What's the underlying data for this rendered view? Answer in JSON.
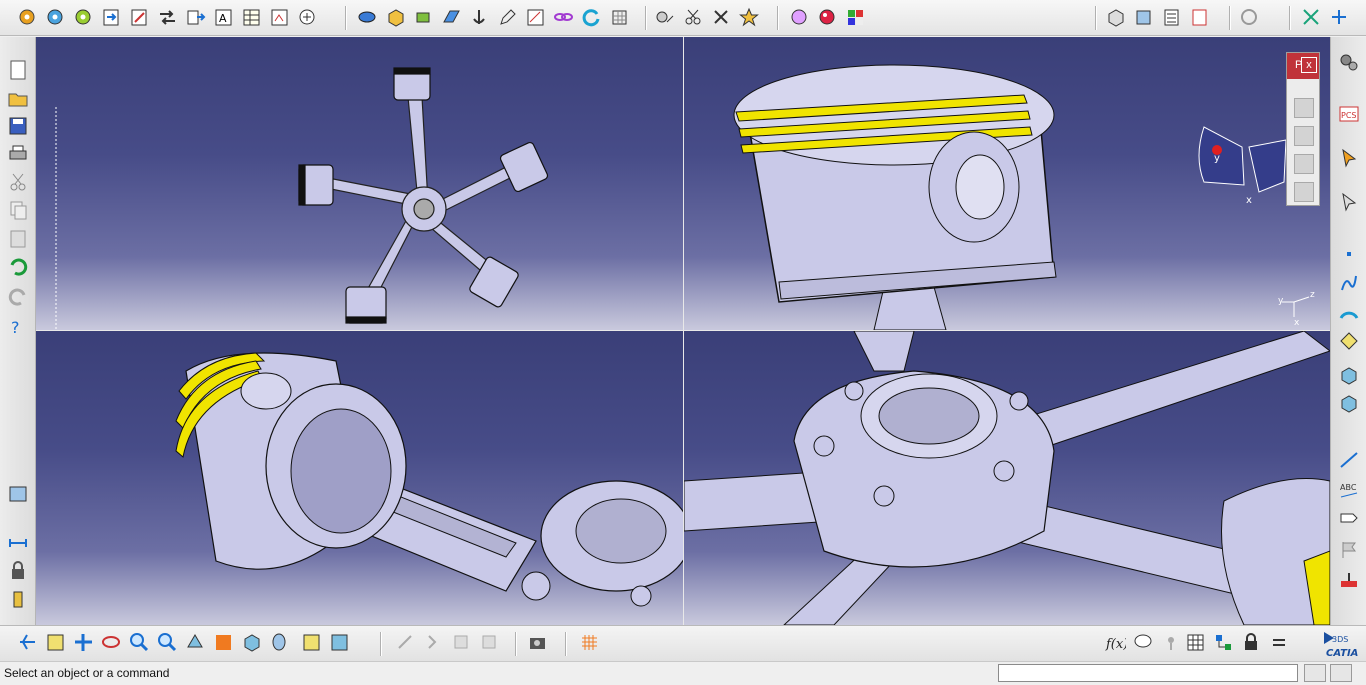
{
  "toolbar_top": {
    "groups": [
      "file-tools",
      "sketcher-tools",
      "constraint-tools",
      "view-tools",
      "workbench-tools"
    ]
  },
  "panel_pcs": {
    "title_label": "P",
    "close_label": "x"
  },
  "compass": {
    "axis_y": "y",
    "axis_x": "x",
    "axis_z": "z"
  },
  "triad_small": {
    "y": "y",
    "z": "z",
    "x": "x"
  },
  "status_bar": {
    "message": "Select an object or a command",
    "command_input": ""
  },
  "logo": {
    "text": "CATIA",
    "brand": "3DS"
  },
  "colors": {
    "viewport_top": "#3a3f78",
    "viewport_bottom": "#c9c9dd",
    "part_fill": "#c9c9e8",
    "ring_yellow": "#f0e400",
    "panel_red": "#c0333a"
  },
  "icons": {
    "fx": "f(x)",
    "pcs": "PCS",
    "abc": "ABC"
  }
}
